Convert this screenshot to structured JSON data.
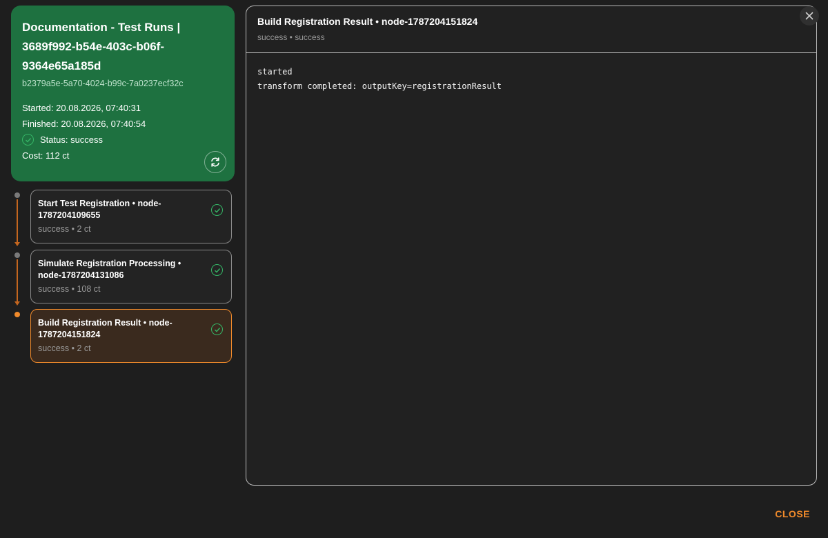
{
  "run": {
    "title": "Documentation - Test Runs | 3689f992-b54e-403c-b06f-9364e65a185d",
    "id": "b2379a5e-5a70-4024-b99c-7a0237ecf32c",
    "started": "Started: 20.08.2026, 07:40:31",
    "finished": "Finished: 20.08.2026, 07:40:54",
    "status": "Status: success",
    "cost": "Cost: 112 ct"
  },
  "steps": [
    {
      "title": "Start Test Registration • node-1787204109655",
      "sub": "success • 2 ct"
    },
    {
      "title": "Simulate Registration Processing • node-1787204131086",
      "sub": "success • 108 ct"
    },
    {
      "title": "Build Registration Result • node-1787204151824",
      "sub": "success • 2 ct"
    }
  ],
  "detail": {
    "title": "Build Registration Result • node-1787204151824",
    "sub": "success • success",
    "log": [
      "started",
      "transform completed: outputKey=registrationResult"
    ]
  },
  "actions": {
    "close_label": "CLOSE"
  },
  "colors": {
    "run_card": "#1e7140",
    "accent": "#f08a2b",
    "success": "#35b566"
  }
}
